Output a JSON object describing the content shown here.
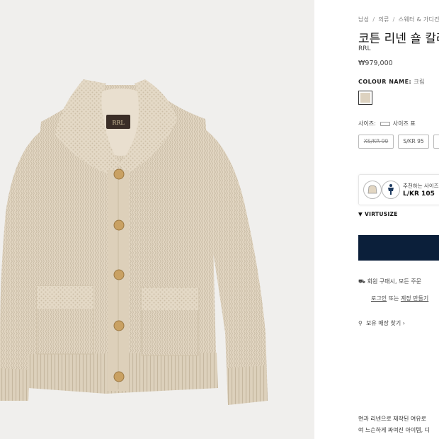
{
  "breadcrumb": [
    "남성",
    "의류",
    "스웨터 & 가디건"
  ],
  "product": {
    "title": "코튼 리넨 숄 칼라",
    "brand": "RRL",
    "price": "₩979,000",
    "label_text": "RRL"
  },
  "colour": {
    "label": "COLOUR NAME:",
    "value": "크림",
    "swatch_color": "#ddd2c0"
  },
  "size": {
    "label": "사이즈:",
    "guide": "사이즈 표",
    "options": [
      {
        "label": "XS/KR 90",
        "available": false
      },
      {
        "label": "S/KR 95",
        "available": true
      }
    ]
  },
  "recommendation": {
    "line1": "추천하는 사이즈",
    "line2": "L/KR 105"
  },
  "virtusize": {
    "label": "VIRTUSIZE"
  },
  "colors": {
    "cta": "#0b1f3a",
    "background": "#f0efed"
  },
  "shipping": {
    "text": "회원 구매시, 모든 주문"
  },
  "account": {
    "login": "로그인",
    "or": "또는",
    "create": "계정 만들기"
  },
  "store": {
    "label": "보유 매장 찾기"
  },
  "description": {
    "line1": "면과 리넨으로 제작된 여유로",
    "line2": "여 느슨하게 짜여진 아이템, 디"
  }
}
